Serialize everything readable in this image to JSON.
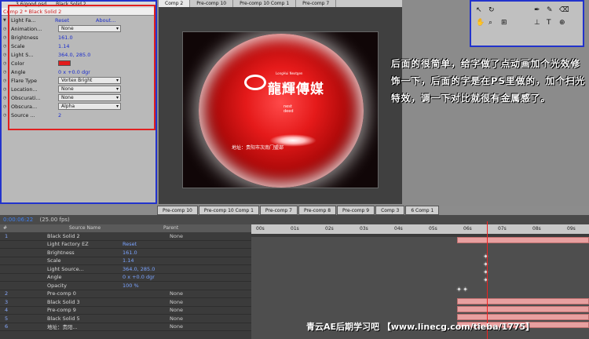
{
  "fx_panel": {
    "header": "3 6/good.psd",
    "header2": "Black Solid 2",
    "tab": "Comp 2 * Black Solid 2",
    "effect_name": "Light Fa...",
    "reset": "Reset",
    "about": "About...",
    "rows": [
      {
        "label": "Animation...",
        "value": "None",
        "kind": "dropdown"
      },
      {
        "label": "Brightness",
        "value": "161.0",
        "kind": "value"
      },
      {
        "label": "Scale",
        "value": "1.14",
        "kind": "value"
      },
      {
        "label": "Light S...",
        "value": "364.0, 285.0",
        "kind": "value"
      },
      {
        "label": "Color",
        "value": "",
        "kind": "color"
      },
      {
        "label": "Angle",
        "value": "0 x +0.0 dgr",
        "kind": "value"
      },
      {
        "label": "Flare Type",
        "value": "Vortex Bright",
        "kind": "dropdown"
      },
      {
        "label": "Location...",
        "value": "None",
        "kind": "dropdown"
      },
      {
        "label": "Obscurati...",
        "value": "None",
        "kind": "dropdown"
      },
      {
        "label": "Obscura...",
        "value": "Alpha",
        "kind": "dropdown"
      },
      {
        "label": "Source ...",
        "value": "2",
        "kind": "value"
      }
    ],
    "color_hex": "#e31c1c"
  },
  "comp": {
    "tabs": [
      "Comp 2",
      "Pre-comp 10",
      "Pre-comp 10 Comp 1",
      "Pre-comp 7"
    ],
    "logo_small": "LongHui Nextgen",
    "logo_text": "龍輝傳媒",
    "nest": "nest\ndeed",
    "address": "地址：贵阳市次南门盟部"
  },
  "caption": "后面的很简单，给字做了点动画加个光效修饰一下，后面的字是在PS里做的，加个扫光特效，调一下对比就很有金属感了。",
  "timeline": {
    "tabs": [
      "Pre-comp 10",
      "Pre-comp 10 Comp 1",
      "Pre-comp 7",
      "Pre-comp 8",
      "Pre-comp 9",
      "Comp 3",
      "6 Comp 1"
    ],
    "time": "0:00:06:22",
    "fps": "(25.00 fps)",
    "headers": {
      "source": "Source Name",
      "parent": "Parent"
    },
    "ruler": [
      "00s",
      "01s",
      "02s",
      "03s",
      "04s",
      "05s",
      "06s",
      "07s",
      "08s",
      "09s"
    ],
    "layers": [
      {
        "num": "1",
        "name": "Black Solid 2",
        "value": "",
        "parent": "None"
      },
      {
        "num": "",
        "name": "Light Factory EZ",
        "value": "Reset",
        "parent": ""
      },
      {
        "num": "",
        "name": "Brightness",
        "value": "161.0",
        "parent": ""
      },
      {
        "num": "",
        "name": "Scale",
        "value": "1.14",
        "parent": ""
      },
      {
        "num": "",
        "name": "Light Source...",
        "value": "364.0, 285.0",
        "parent": ""
      },
      {
        "num": "",
        "name": "Angle",
        "value": "0 x +0.0 dgr",
        "parent": ""
      },
      {
        "num": "",
        "name": "Opacity",
        "value": "100 %",
        "parent": ""
      },
      {
        "num": "2",
        "name": "Pre-comp 0",
        "value": "",
        "parent": "None"
      },
      {
        "num": "3",
        "name": "Black Solid 3",
        "value": "",
        "parent": "None"
      },
      {
        "num": "4",
        "name": "Pre-comp 9",
        "value": "",
        "parent": "None"
      },
      {
        "num": "5",
        "name": "Black Solid 5",
        "value": "",
        "parent": "None"
      },
      {
        "num": "6",
        "name": "地址：贵阳...",
        "value": "",
        "parent": "None"
      }
    ]
  },
  "watermark": "青云AE后期学习吧 【www.linecg.com/tieba/1775】"
}
